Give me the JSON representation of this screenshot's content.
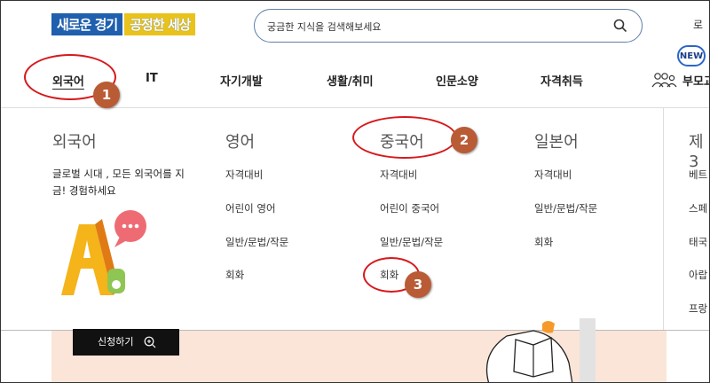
{
  "header": {
    "logo_part1": "새로운 경기",
    "logo_part2": "공정한 세상",
    "search_placeholder": "궁금한 지식을 검색해보세요",
    "right_text": "로"
  },
  "nav": {
    "items": [
      "외국어",
      "IT",
      "자기개발",
      "생활/취미",
      "인문소양",
      "자격취득",
      "부모교"
    ],
    "new_badge": "NEW"
  },
  "menu": {
    "columns": [
      {
        "title": "외국어",
        "description": "글로벌 시대 , 모든 외국어를 지금! 경험하세요",
        "links": []
      },
      {
        "title": "영어",
        "links": [
          "자격대비",
          "어린이 영어",
          "일반/문법/작문",
          "회화"
        ]
      },
      {
        "title": "중국어",
        "links": [
          "자격대비",
          "어린이 중국어",
          "일반/문법/작문",
          "회화"
        ]
      },
      {
        "title": "일본어",
        "links": [
          "자격대비",
          "일반/문법/작문",
          "회화"
        ]
      },
      {
        "title": "제3",
        "links": [
          "베트",
          "스페",
          "태국",
          "아랍",
          "프랑"
        ]
      }
    ]
  },
  "banner": {
    "apply_button": "신청하기"
  },
  "annotations": {
    "markers": [
      "1",
      "2",
      "3"
    ]
  },
  "colors": {
    "logo_blue": "#1f5fae",
    "logo_yellow": "#e9c31b",
    "annotation_red": "#d7191c",
    "marker_brown": "#b95b35",
    "banner_peach": "#fbe5d8"
  }
}
